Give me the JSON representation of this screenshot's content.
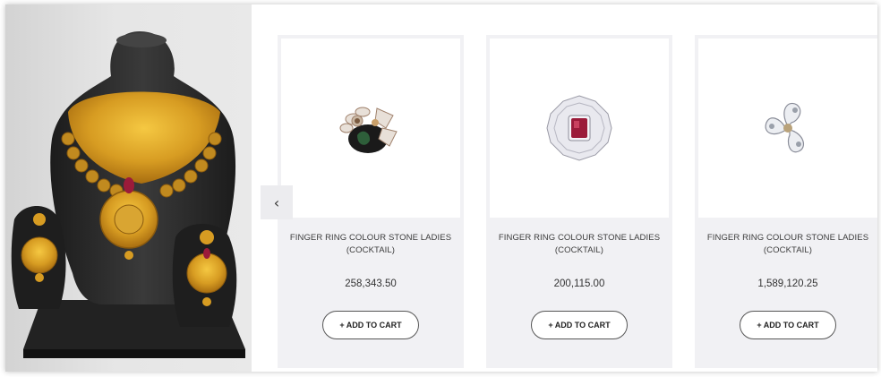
{
  "hero": {
    "icon": "necklace-set-on-black-bust"
  },
  "carousel": {
    "prev_arrow": "‹",
    "products": [
      {
        "title": "FINGER RING COLOUR STONE LADIES (COCKTAIL)",
        "price": "258,343.50",
        "cta": "+ ADD TO CART",
        "image": "floral-ring-with-black-stone"
      },
      {
        "title": "FINGER RING COLOUR STONE LADIES (COCKTAIL)",
        "price": "200,115.00",
        "cta": "+ ADD TO CART",
        "image": "ruby-ring-with-diamond-halo"
      },
      {
        "title": "FINGER RING COLOUR STONE LADIES (COCKTAIL)",
        "price": "1,589,120.25",
        "cta": "+ ADD TO CART",
        "image": "triskelion-diamond-ring"
      }
    ]
  },
  "colors": {
    "card_bg": "#f1f1f4",
    "gold": "#d4a02a",
    "bust": "#2b2b2b",
    "ruby": "#9b1b3a"
  }
}
